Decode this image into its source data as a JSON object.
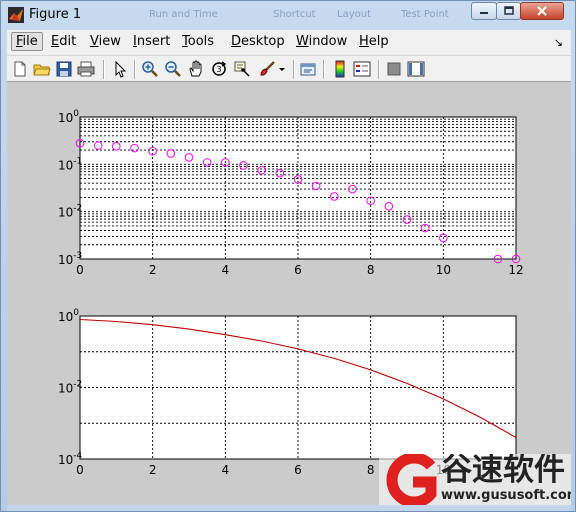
{
  "window": {
    "title": "Figure 1",
    "background_titles": [
      "Run and Time",
      "Shortcut",
      "Layout",
      "Test Point"
    ],
    "controls": {
      "minimize": "minimize",
      "maximize": "maximize",
      "close": "close"
    }
  },
  "menubar": {
    "items": [
      {
        "key": "file",
        "label": "File",
        "mnemonic": "F",
        "rest": "ile"
      },
      {
        "key": "edit",
        "label": "Edit",
        "mnemonic": "E",
        "rest": "dit"
      },
      {
        "key": "view",
        "label": "View",
        "mnemonic": "V",
        "rest": "iew"
      },
      {
        "key": "insert",
        "label": "Insert",
        "mnemonic": "I",
        "rest": "nsert"
      },
      {
        "key": "tools",
        "label": "Tools",
        "mnemonic": "T",
        "rest": "ools"
      },
      {
        "key": "desktop",
        "label": "Desktop",
        "mnemonic": "D",
        "rest": "esktop"
      },
      {
        "key": "window",
        "label": "Window",
        "mnemonic": "W",
        "rest": "indow"
      },
      {
        "key": "help",
        "label": "Help",
        "mnemonic": "H",
        "rest": "elp"
      }
    ],
    "dock_arrow": "↘"
  },
  "toolbar": {
    "buttons": [
      "new-figure-icon",
      "open-folder-icon",
      "save-icon",
      "print-icon",
      "edit-plot-arrow-icon",
      "zoom-in-icon",
      "zoom-out-icon",
      "pan-hand-icon",
      "rotate-3d-icon",
      "data-cursor-icon",
      "brush-icon",
      "brush-dropdown-icon",
      "link-plot-icon",
      "insert-colorbar-icon",
      "insert-legend-icon",
      "hide-plot-tools-icon",
      "show-plot-tools-icon"
    ]
  },
  "watermark": {
    "logo_letter": "G",
    "cn_text": "谷速软件",
    "url": "www.gususoft.com",
    "colors": {
      "red": "#e01f1f"
    }
  },
  "colors": {
    "marker": "#ff00ff",
    "curve": "#c00000",
    "figure_bg": "#cbcbcb"
  },
  "chart_data": [
    {
      "type": "scatter",
      "title": "",
      "xlabel": "",
      "ylabel": "",
      "xlim": [
        0,
        12
      ],
      "ylim": [
        0.001,
        1
      ],
      "yscale": "log",
      "grid": "on (major and minor, dashed)",
      "marker": "o",
      "x_tick_labels": [
        "0",
        "2",
        "4",
        "6",
        "8",
        "10",
        "12"
      ],
      "y_tick_labels": [
        {
          "base": "10",
          "exp": "0"
        },
        {
          "base": "10",
          "exp": "-1"
        },
        {
          "base": "10",
          "exp": "-2"
        },
        {
          "base": "10",
          "exp": "-3"
        }
      ],
      "x": [
        0,
        0.5,
        1,
        1.5,
        2,
        2.5,
        3,
        3.5,
        4,
        4.5,
        5,
        5.5,
        6,
        6.5,
        7,
        7.5,
        8,
        8.5,
        9,
        9.5,
        10,
        11.5,
        12
      ],
      "y": [
        0.28,
        0.25,
        0.24,
        0.22,
        0.19,
        0.17,
        0.14,
        0.11,
        0.11,
        0.095,
        0.075,
        0.065,
        0.048,
        0.035,
        0.021,
        0.03,
        0.017,
        0.013,
        0.0068,
        0.0045,
        0.0028,
        0.001,
        0.001
      ]
    },
    {
      "type": "line",
      "title": "",
      "xlabel": "",
      "ylabel": "",
      "xlim": [
        0,
        12
      ],
      "ylim": [
        0.0001,
        1
      ],
      "yscale": "log",
      "grid": "on (major only, dashed)",
      "x_tick_labels": [
        "0",
        "2",
        "4",
        "6",
        "8",
        "10"
      ],
      "y_tick_labels": [
        {
          "base": "10",
          "exp": "0"
        },
        {
          "base": "10",
          "exp": "-2"
        },
        {
          "base": "10",
          "exp": "-4"
        }
      ],
      "x": [
        0,
        1,
        2,
        3,
        4,
        5,
        6,
        7,
        8,
        9,
        10,
        11,
        12
      ],
      "y": [
        0.8,
        0.7,
        0.57,
        0.43,
        0.3,
        0.2,
        0.12,
        0.065,
        0.031,
        0.013,
        0.0048,
        0.0015,
        0.0004
      ]
    }
  ]
}
